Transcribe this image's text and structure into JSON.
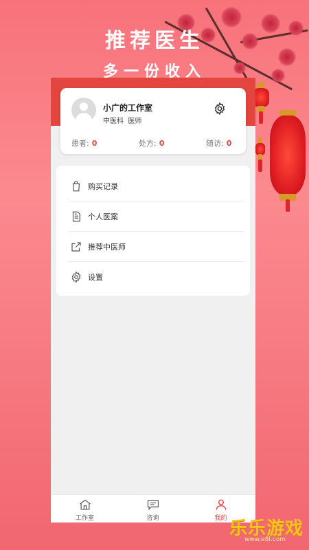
{
  "banner": {
    "line1": "推荐医生",
    "line2": "多一份收入"
  },
  "profile": {
    "studio_name": "小广的工作室",
    "department": "中医科",
    "title": "医师",
    "stats": [
      {
        "label": "患者:",
        "value": "0"
      },
      {
        "label": "处方:",
        "value": "0"
      },
      {
        "label": "随访:",
        "value": "0"
      }
    ]
  },
  "menu": [
    {
      "label": "购买记录",
      "icon": "bag-icon"
    },
    {
      "label": "个人医案",
      "icon": "document-icon"
    },
    {
      "label": "推荐中医师",
      "icon": "share-icon"
    },
    {
      "label": "设置",
      "icon": "gear-icon"
    }
  ],
  "tabs": [
    {
      "label": "工作室",
      "icon": "home-icon",
      "active": false
    },
    {
      "label": "咨询",
      "icon": "chat-icon",
      "active": false
    },
    {
      "label": "我的",
      "icon": "user-icon",
      "active": true
    }
  ],
  "watermark": {
    "text": "乐乐游戏",
    "sub": "www.e8l.com"
  },
  "colors": {
    "accent": "#e2463f",
    "background": "#f8727a",
    "watermark": "#f7c21d"
  }
}
